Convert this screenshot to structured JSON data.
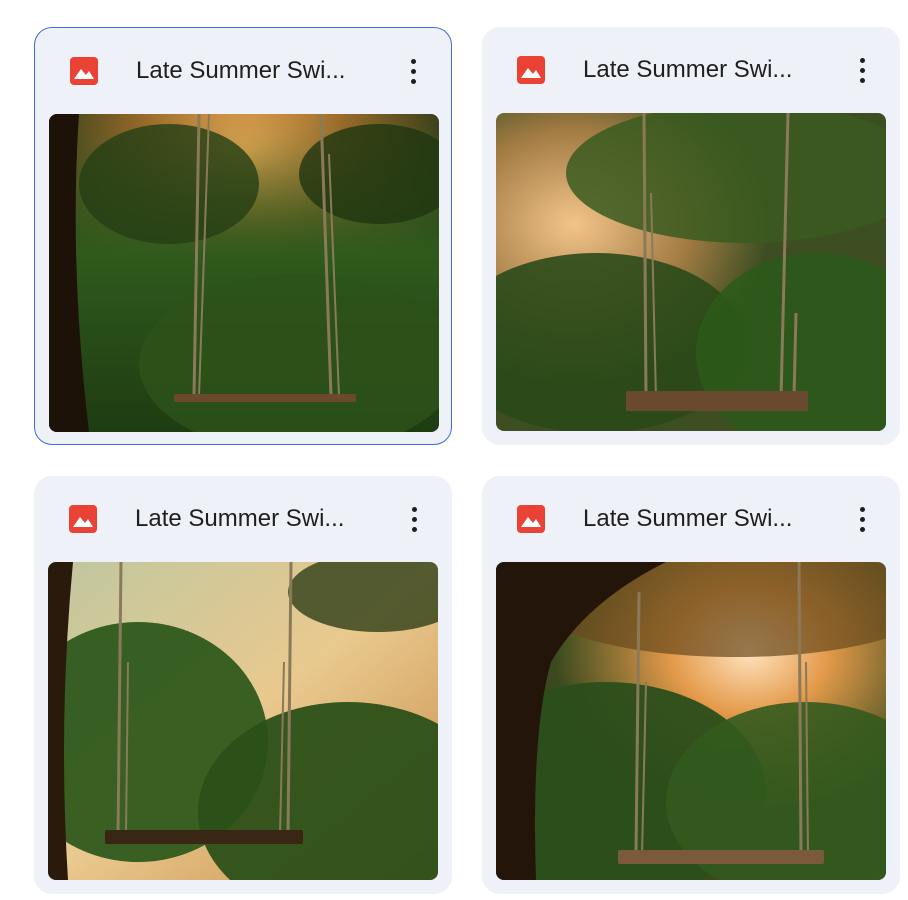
{
  "files": [
    {
      "title": "Late Summer Swi...",
      "selected": true
    },
    {
      "title": "Late Summer Swi...",
      "selected": false
    },
    {
      "title": "Late Summer Swi...",
      "selected": false
    },
    {
      "title": "Late Summer Swi...",
      "selected": false
    }
  ],
  "icons": {
    "file_type": "image-file-icon",
    "menu": "more-vert-icon"
  },
  "colors": {
    "image_icon": "#ea4335",
    "selection_border": "#3b6fd6",
    "card_bg": "#eef1f7"
  }
}
